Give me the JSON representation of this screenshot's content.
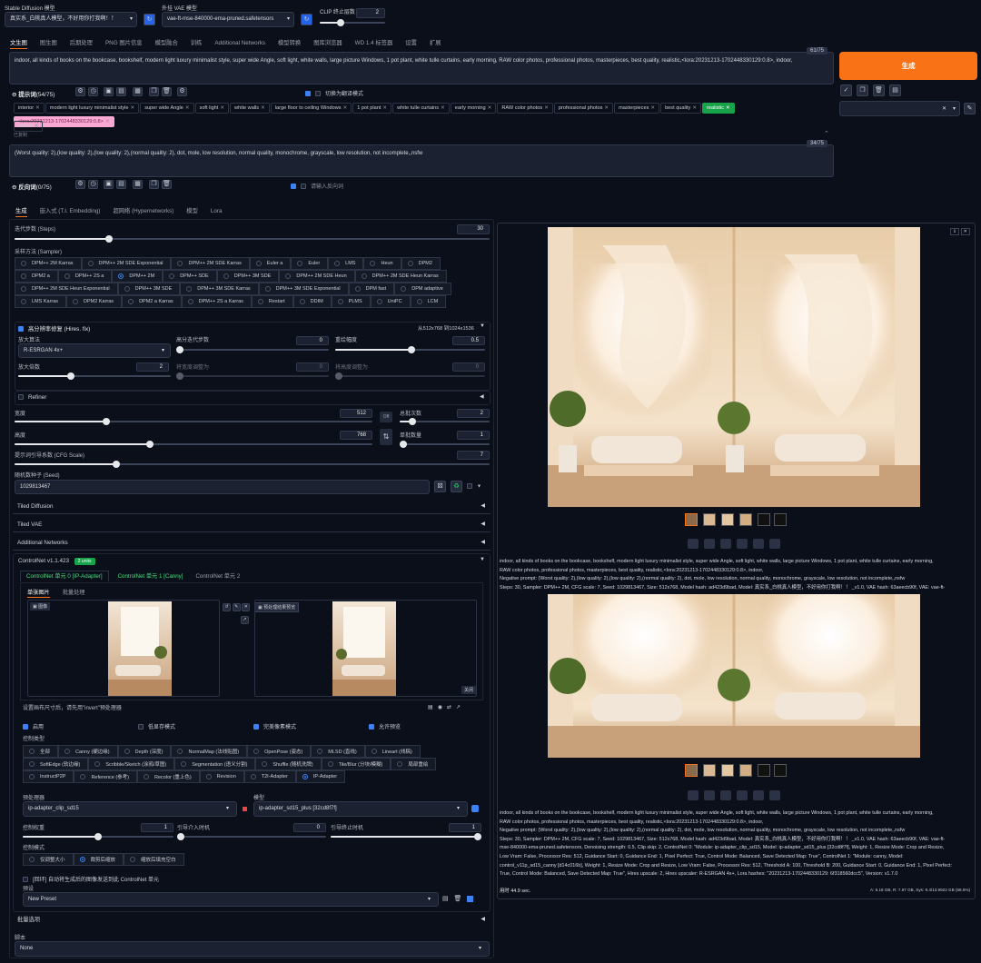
{
  "top": {
    "sd_model_label": "Stable Diffusion 模型",
    "sd_model_value": "真实系_白桃真人模型，不好用你打我啊！！",
    "vae_label": "外挂 VAE 模型",
    "vae_value": "vae-ft-mse-840000-ema-pruned.safetensors",
    "clip_label": "CLIP 终止层数",
    "clip_value": "2"
  },
  "main_tabs": [
    "文生图",
    "图生图",
    "后期处理",
    "PNG 图片信息",
    "模型融合",
    "训练",
    "Additional Networks",
    "模型转换",
    "图库浏览器",
    "WD 1.4 标签器",
    "设置",
    "扩展"
  ],
  "prompt": {
    "text": "indoor, all kinds of books on the bookcase, bookshelf, modern light luxury minimalist style, super wide Angle, soft light, white walls, large picture Windows, 1 pot plant, white tulle curtains, early morning, RAW color photos, professional photos, masterpieces, best quality, realistic,<lora:20231213-1702448330129:0.8>, indoor,",
    "counter": "61/75",
    "title": "提示词",
    "title_count": "(54/75)",
    "translate": "切换为翻译模式",
    "tags": [
      "interior",
      "modern light luxury minimalist style",
      "super wide Angle",
      "soft light",
      "white walls",
      "large floor to ceiling Windows",
      "1 pot plant",
      "white tulle curtains",
      "early morning",
      "RAW color photos",
      "professional photos",
      "masterpieces",
      "best quality"
    ],
    "tag_realistic": "realistic",
    "tag_lora": "<lora:20231213-1702448330129:0.8>",
    "tag_indoor": "indoor",
    "hint": "已复制"
  },
  "negative": {
    "text": "(Worst quality: 2),(low quality: 2),(low quality: 2),(normal quality: 2), dot, mole, low resolution, normal quality, monochrome, grayscale, low resolution, not incomplete,,nsfw",
    "counter": "34/75",
    "title": "反向词",
    "title_count": "(0/75)",
    "input": "请输入反向词"
  },
  "generate_label": "生成",
  "sub_tabs": [
    "生成",
    "嵌入式 (T.I. Embedding)",
    "超网络 (Hypernetworks)",
    "模型",
    "Lora"
  ],
  "steps": {
    "label": "迭代步数 (Steps)",
    "value": "30",
    "fill": 0.2
  },
  "sampler": {
    "label": "采样方法 (Sampler)",
    "options": [
      "DPM++ 2M Karras",
      "DPM++ 2M SDE Exponential",
      "DPM++ 2M SDE Karras",
      "Euler a",
      "Euler",
      "LMS",
      "Heun",
      "DPM2",
      "DPM2 a",
      "DPM++ 2S a",
      "DPM++ 2M",
      "DPM++ SDE",
      "DPM++ 3M SDE",
      "DPM++ 2M SDE Heun",
      "DPM++ 2M SDE Heun Karras",
      "DPM++ 2M SDE Heun Exponential",
      "DPM++ 3M SDE",
      "DPM++ 3M SDE Karras",
      "DPM++ 3M SDE Exponential",
      "DPM fast",
      "DPM adaptive",
      "LMS Karras",
      "DPM2 Karras",
      "DPM2 a Karras",
      "DPM++ 2S a Karras",
      "Restart",
      "DDIM",
      "PLMS",
      "UniPC",
      "LCM"
    ],
    "selected": "DPM++ 2M"
  },
  "hires": {
    "title": "高分辨率修复 (Hires. fix)",
    "size": "从512x768 到1024x1536",
    "upscaler_label": "放大算法",
    "upscaler_value": "R-ESRGAN 4x+",
    "steps_label": "高分迭代步数",
    "steps_value": "0",
    "denoise_label": "重绘幅度",
    "denoise_value": "0.5",
    "scale_label": "放大倍数",
    "scale_value": "2",
    "w_label": "将宽度调整为",
    "w_value": "0",
    "h_label": "将高度调整为",
    "h_value": "0"
  },
  "refiner": "Refiner",
  "dims": {
    "width_label": "宽度",
    "width_value": "512",
    "height_label": "高度",
    "height_value": "768",
    "batch_count_label": "总批次数",
    "batch_count_value": "2",
    "batch_size_label": "单批数量",
    "batch_size_value": "1",
    "cfg_label": "提示词引导系数 (CFG Scale)",
    "cfg_value": "7",
    "swap": "⇅"
  },
  "seed": {
    "label": "随机数种子 (Seed)",
    "value": "1029813467"
  },
  "accordions": [
    "Tiled Diffusion",
    "Tiled VAE",
    "Additional Networks"
  ],
  "controlnet": {
    "title": "ControlNet v1.1.423",
    "badge": "2 units",
    "unit_tabs": [
      "ControlNet 单元 0 [IP-Adapter]",
      "ControlNet 单元 1 [Canny]",
      "ControlNet 单元 2"
    ],
    "img_tabs": [
      "单张图片",
      "批量处理"
    ],
    "img_label": "图像",
    "preview_label": "预处理结果预览",
    "open_label": "关闭",
    "hint": "设置画布尺寸后，请先用\"invert\"预处理器",
    "enable": "启用",
    "lowvram": "低显存模式",
    "pixel": "完美像素模式",
    "preview": "允许预览",
    "control_type_label": "控制类型",
    "types": [
      "全部",
      "Canny (硬边缘)",
      "Depth (深度)",
      "NormalMap (法线贴图)",
      "OpenPose (姿态)",
      "MLSD (直线)",
      "Lineart (线稿)",
      "SoftEdge (软边缘)",
      "Scribble/Sketch (涂鸦/草图)",
      "Segmentation (语义分割)",
      "Shuffle (随机洗牌)",
      "Tile/Blur (分块/模糊)",
      "局部重绘",
      "InstructP2P",
      "Reference (参考)",
      "Recolor (重上色)",
      "Revision",
      "T2I-Adapter",
      "IP-Adapter"
    ],
    "type_selected": "IP-Adapter",
    "preprocessor_label": "预处理器",
    "preprocessor_value": "ip-adapter_clip_sd15",
    "model_label": "模型",
    "model_value": "ip-adapter_sd15_plus [32cd8f7f]",
    "weight_label": "控制权重",
    "weight_value": "1",
    "start_label": "引导介入时机",
    "start_value": "0",
    "end_label": "引导终止时机",
    "end_value": "1",
    "mode_label": "控制模式",
    "modes": [
      "仅调整大小",
      "裁剪后缩放",
      "缩放后填充空白"
    ],
    "mode_selected": "裁剪后缩放",
    "loop_text": "[回环] 自动将生成后的图像发送到此 ControlNet 单元",
    "preset_label": "预设",
    "preset_value": "New Preset"
  },
  "batch_opts": "批量选项",
  "script": {
    "label": "脚本",
    "value": "None"
  },
  "output": {
    "info1": [
      "indoor, all kinds of books on the bookcase, bookshelf, modern light luxury minimalist style, super wide Angle, soft light, white walls, large picture Windows, 1 pot plant, white tulle curtains, early morning,",
      "RAW color photos, professional photos, masterpieces, best quality, realistic,<lora:20231213-1702448330129:0.8>, indoor,",
      "Negative prompt: (Worst quality: 2),(low quality: 2),(low quality: 2),(normal quality: 2), dot, mole, low resolution, normal quality, monochrome, grayscale, low resolution, not incomplete,,nsfw",
      "Steps: 30, Sampler: DPM++ 2M, CFG scale: 7, Seed: 1029813467, Size: 512x768, Model hash: ad423d9bad, Model: 真实系_白桃真人模型，不好用你打我啊！！ _v1.0, VAE hash: 63aeecb90f, VAE: vae-ft-"
    ],
    "info2": [
      "indoor, all kinds of books on the bookcase, bookshelf, modern light luxury minimalist style, super wide Angle, soft light, white walls, large picture Windows, 1 pot plant, white tulle curtains, early morning,",
      "RAW color photos, professional photos, masterpieces, best quality, realistic,<lora:20231213-1702448330129:0.8>, indoor,",
      "Negative prompt: (Worst quality: 2),(low quality: 2),(low quality: 2),(normal quality: 2), dot, mole, low resolution, normal quality, monochrome, grayscale, low resolution, not incomplete,,nsfw",
      "Steps: 30, Sampler: DPM++ 2M, CFG scale: 7, Seed: 1029813467, Size: 512x768, Model hash: ad423d9bad, Model: 真实系_白桃真人模型，不好用你打我啊！！ _v1.0, VAE hash: 63aeecb90f, VAE: vae-ft-",
      "mse-840000-ema-pruned.safetensors, Denoising strength: 0.5, Clip skip: 2, ControlNet 0: \"Module: ip-adapter_clip_sd15, Model: ip-adapter_sd15_plus [32cd8f7f], Weight: 1, Resize Mode: Crop and Resize,",
      "Low Vram: False, Processor Res: 512, Guidance Start: 0, Guidance End: 1, Pixel Perfect: True, Control Mode: Balanced, Save Detected Map: True\", ControlNet 1: \"Module: canny, Model:",
      "control_v11p_sd15_canny [d14c016b], Weight: 1, Resize Mode: Crop and Resize, Low Vram: False, Processor Res: 512, Threshold A: 100, Threshold B: 200, Guidance Start: 0, Guidance End: 1, Pixel Perfect:",
      "True, Control Mode: Balanced, Save Detected Map: True\", Hires upscale: 2, Hires upscaler: R-ESRGAN 4x+, Lora hashes: \"20231213-1702448330129: 6f318560dcc5\", Version: v1.7.0"
    ],
    "time": "用时 44.9 sec.",
    "vram": "A: 6.16 GB, R: 7.97 GB, Sys: 9.4/13.9922 GB (58.6%)"
  },
  "colors": {
    "accent": "#f97316",
    "primary_blue": "#3b82f6",
    "success": "#16a34a"
  }
}
